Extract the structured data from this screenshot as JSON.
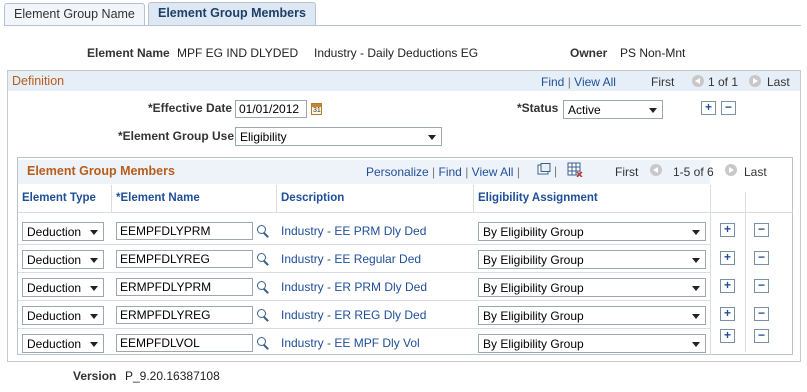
{
  "tabs": [
    {
      "label": "Element Group Name",
      "active": false
    },
    {
      "label": "Element Group Members",
      "active": true
    }
  ],
  "header": {
    "element_name_label": "Element Name",
    "element_name_value": "MPF EG IND DLYDED",
    "element_desc": "Industry - Daily Deductions EG",
    "owner_label": "Owner",
    "owner_value": "PS Non-Mnt"
  },
  "definition": {
    "title": "Definition",
    "nav": {
      "find": "Find",
      "view_all": "View All",
      "first": "First",
      "range": "1 of 1",
      "last": "Last"
    },
    "effective_date_label": "*Effective Date",
    "effective_date_value": "01/01/2012",
    "calendar_icon_text": "31",
    "status_label": "*Status",
    "status_value": "Active",
    "group_use_label": "*Element Group Use",
    "group_use_value": "Eligibility",
    "add_label": "+",
    "remove_label": "−"
  },
  "members": {
    "title": "Element Group Members",
    "nav": {
      "personalize": "Personalize",
      "find": "Find",
      "view_all": "View All",
      "first": "First",
      "range": "1-5 of 6",
      "last": "Last"
    },
    "columns": [
      "Element Type",
      "*Element Name",
      "Description",
      "Eligibility Assignment"
    ],
    "rows": [
      {
        "type": "Deduction",
        "name": "EEMPFDLYPRM",
        "desc": "Industry - EE PRM Dly Ded",
        "assign": "By Eligibility Group"
      },
      {
        "type": "Deduction",
        "name": "EEMPFDLYREG",
        "desc": "Industry - EE Regular Ded",
        "assign": "By Eligibility Group"
      },
      {
        "type": "Deduction",
        "name": "ERMPFDLYPRM",
        "desc": "Industry - ER PRM Dly Ded",
        "assign": "By Eligibility Group"
      },
      {
        "type": "Deduction",
        "name": "ERMPFDLYREG",
        "desc": "Industry - ER REG Dly Ded",
        "assign": "By Eligibility Group"
      },
      {
        "type": "Deduction",
        "name": "EEMPFDLVOL",
        "desc": "Industry - EE MPF Dly Vol",
        "assign": "By Eligibility Group"
      }
    ]
  },
  "footer": {
    "version_label": "Version",
    "version_value": "P_9.20.16387108"
  },
  "colors": {
    "link": "#1f4e99",
    "section_title": "#b85c1a",
    "header_bg": "#e6eef7"
  }
}
